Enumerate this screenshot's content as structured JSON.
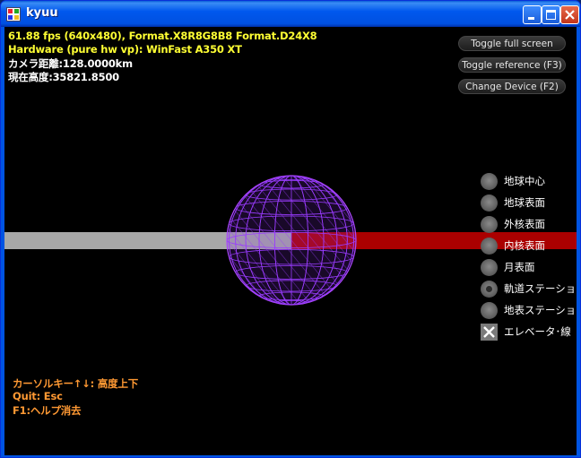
{
  "window": {
    "title": "kyuu"
  },
  "info": {
    "fps": "61.88 fps (640x480), Format.X8R8G8B8 Format.D24X8",
    "hardware": "Hardware (pure hw vp): WinFast A350 XT",
    "camera_distance": "カメラ距離:128.0000km",
    "current_altitude": "現在高度:35821.8500"
  },
  "buttons": {
    "fullscreen": "Toggle full screen",
    "reference": "Toggle reference (F3)",
    "device": "Change Device (F2)"
  },
  "options": [
    {
      "label": "地球中心",
      "selected": false
    },
    {
      "label": "地球表面",
      "selected": false
    },
    {
      "label": "外核表面",
      "selected": false
    },
    {
      "label": "内核表面",
      "selected": false
    },
    {
      "label": "月表面",
      "selected": false
    },
    {
      "label": "軌道ステーション",
      "selected": true
    },
    {
      "label": "地表ステーション",
      "selected": false
    }
  ],
  "elevator_checkbox": {
    "label": "エレベータ･線",
    "checked": true
  },
  "help": {
    "line1": "カーソルキー↑↓: 高度上下",
    "line2": "Quit: Esc",
    "line3": "F1:ヘルプ消去"
  },
  "colors": {
    "info_text": "#ffff33",
    "help_text": "#ff9933",
    "sphere": "#9933ff",
    "bar_left": "#a8a8a8",
    "bar_right": "#aa0000"
  }
}
